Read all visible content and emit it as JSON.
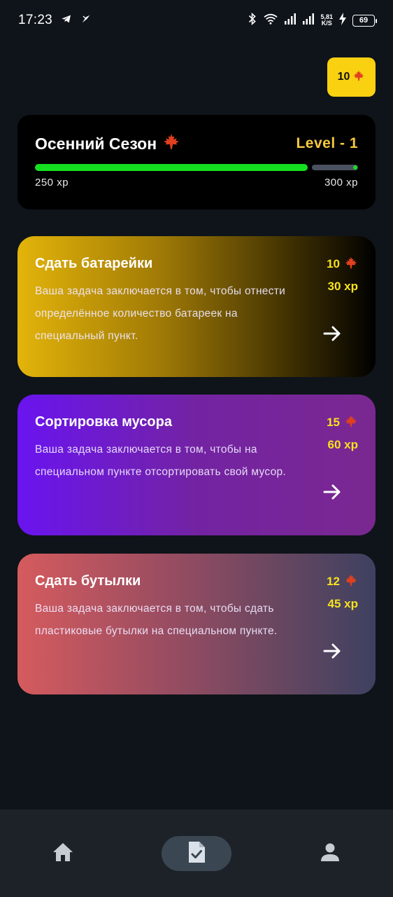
{
  "status_bar": {
    "time": "17:23",
    "net_speed_value": "5,81",
    "net_speed_unit": "K/S",
    "battery": "69"
  },
  "leaf_balance": {
    "count": "10",
    "icon": "maple-leaf-icon"
  },
  "season": {
    "title": "Осенний Сезон",
    "level": "Level - 1",
    "xp_current": "250 xp",
    "xp_target": "300 xp",
    "progress": 0.833,
    "progress_color": "#15e020"
  },
  "tasks": [
    {
      "title": "Сдать батарейки",
      "description": "Ваша задача заключается в том, чтобы отнести определённое количество батареек на специальный пункт.",
      "leaves": "10",
      "xp": "30 xp"
    },
    {
      "title": "Сортировка мусора",
      "description": "Ваша задача заключается в том, чтобы на специальном пункте отсортировать свой мусор.",
      "leaves": "15",
      "xp": "60 xp"
    },
    {
      "title": "Сдать бутылки",
      "description": "Ваша задача заключается в том, чтобы сдать пластиковые бутылки на специальном пункте.",
      "leaves": "12",
      "xp": "45 xp"
    }
  ],
  "bottom_nav": {
    "items": [
      "home-icon",
      "task-check-icon",
      "person-icon"
    ],
    "active": "task-check-icon"
  },
  "colors": {
    "background": "#0f141a",
    "accent_yellow": "#fad111",
    "level_text": "#f6c93e",
    "reward_text": "#f6e21e",
    "nav_background": "#1c2228"
  }
}
